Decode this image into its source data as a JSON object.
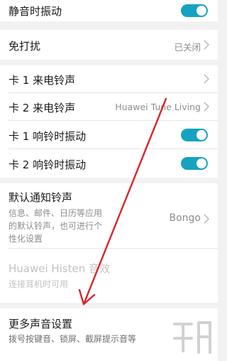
{
  "rows": {
    "vibrate_when_silent": {
      "label": "静音时振动",
      "toggle_on": true
    },
    "do_not_disturb": {
      "label": "免打扰",
      "value": "已关闭"
    },
    "sim1_ringtone": {
      "label": "卡 1 来电铃声",
      "value": ""
    },
    "sim2_ringtone": {
      "label": "卡 2 来电铃声",
      "value": "Huawei Tune Living"
    },
    "sim1_vibrate": {
      "label": "卡 1 响铃时振动",
      "toggle_on": true
    },
    "sim2_vibrate": {
      "label": "卡 2 响铃时振动",
      "toggle_on": true
    },
    "default_notification": {
      "label": "默认通知铃声",
      "desc_line1": "信息、邮件、日历等应用",
      "desc_line2": "的默认铃声，也可进行个",
      "desc_line3": "性化设置",
      "value": "Bongo"
    },
    "histen": {
      "label": "Huawei Histen 音效",
      "desc": "连接耳机时可用"
    },
    "more_sound": {
      "label": "更多声音设置",
      "desc": "拨号按键音、锁屏、截屏提示音等"
    }
  },
  "colors": {
    "accent": "#16a3bf",
    "arrow": "#d9252a"
  }
}
